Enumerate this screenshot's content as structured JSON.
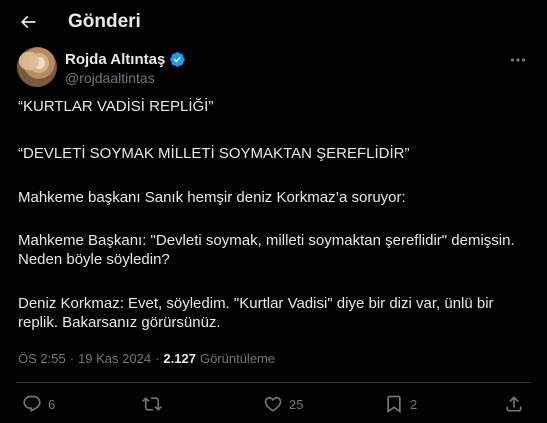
{
  "header": {
    "title": "Gönderi"
  },
  "author": {
    "name": "Rojda Altıntaş",
    "handle": "@rojdaaltintas"
  },
  "tweet": {
    "paragraphs": [
      "“KURTLAR VADİSİ REPLİĞİ”",
      "“DEVLETİ SOYMAK MİLLETİ SOYMAKTAN ŞEREFLİDİR”",
      "Mahkeme başkanı Sanık hemşir deniz Korkmaz’a soruyor:",
      "Mahkeme Başkanı: \"Devleti soymak, milleti soymaktan şereflidir\" demişsin. Neden böyle söyledin?",
      "Deniz Korkmaz: Evet, söyledim. \"Kurtlar Vadisi\" diye bir dizi var, ünlü bir replik. Bakarsanız görürsünüz."
    ]
  },
  "meta": {
    "time": "ÖS 2:55",
    "sep1": "·",
    "date": "19 Kas 2024",
    "sep2": "·",
    "views_count": "2.127",
    "views_label": "Görüntüleme"
  },
  "actions": {
    "replies": "6",
    "reposts": "",
    "likes": "25",
    "bookmarks": "2"
  },
  "colors": {
    "background": "#000000",
    "text": "#e7e9ea",
    "secondary": "#71767b",
    "verified": "#1d9bf0",
    "divider": "#2f3336"
  },
  "icons": {
    "back": "arrow-left-icon",
    "verified": "verified-badge-icon",
    "more": "more-dots-icon",
    "reply": "reply-icon",
    "repost": "repost-icon",
    "like": "heart-icon",
    "bookmark": "bookmark-icon",
    "share": "share-icon"
  }
}
